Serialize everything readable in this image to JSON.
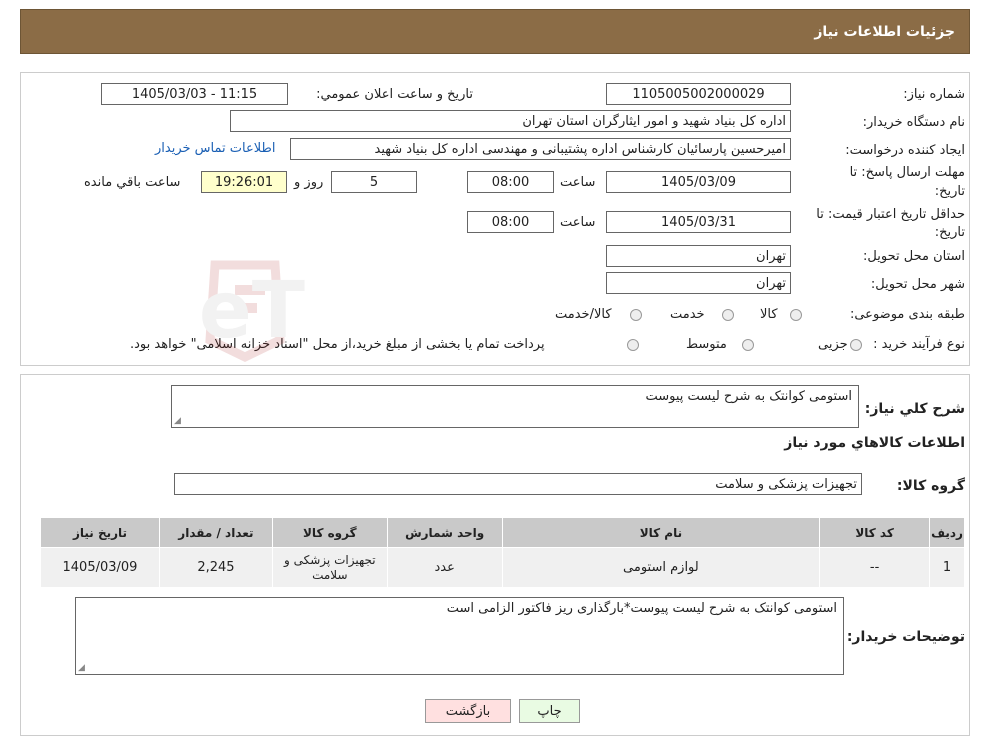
{
  "header": {
    "title": "جزئیات اطلاعات نیاز"
  },
  "form": {
    "need_number_label": "شماره نیاز:",
    "need_number": "1105005002000029",
    "announce_label": "تاريخ و ساعت اعلان عمومي:",
    "announce_value": "1405/03/03 - 11:15",
    "buyer_org_label": "نام دستگاه خریدار:",
    "buyer_org": "اداره کل بنیاد شهید و امور ایثارگران استان تهران",
    "creator_label": "ایجاد کننده درخواست:",
    "creator": "امیرحسین پارسائیان کارشناس اداره پشتیبانی و مهندسی  اداره کل بنیاد شهید",
    "contact_link": "اطلاعات تماس خریدار",
    "deadline_label_1": "مهلت ارسال پاسخ: تا",
    "deadline_label_2": "تاریخ:",
    "deadline_date": "1405/03/09",
    "time_label": "ساعت",
    "deadline_time": "08:00",
    "days": "5",
    "days_label": "روز و",
    "remaining_time": "19:26:01",
    "remaining_label": "ساعت باقي مانده",
    "validity_label_1": "حداقل تاریخ اعتبار قیمت: تا",
    "validity_label_2": "تاریخ:",
    "validity_date": "1405/03/31",
    "validity_time": "08:00",
    "province_label": "استان محل تحویل:",
    "province": "تهران",
    "city_label": "شهر محل تحویل:",
    "city": "تهران",
    "category_label": "طبقه بندی موضوعی:",
    "category_options": [
      "کالا",
      "خدمت",
      "کالا/خدمت"
    ],
    "process_label": "نوع فرآیند خرید :",
    "process_options": [
      "جزیی",
      "متوسط"
    ],
    "process_note": "پرداخت تمام یا بخشی از مبلغ خرید،از محل \"اسناد خزانه اسلامی\" خواهد بود."
  },
  "summary": {
    "desc_label": "شرح کلي نياز:",
    "desc": "استومی  کوانتک به شرح لیست پیوست",
    "items_title": "اطلاعات کالاهاي مورد نياز",
    "group_label": "گروه کالا:",
    "group": "تجهیزات پزشکی و سلامت"
  },
  "table": {
    "headers": [
      "رديف",
      "کد کالا",
      "نام کالا",
      "واحد شمارش",
      "گروه کالا",
      "تعداد / مقدار",
      "تاريخ نياز"
    ],
    "rows": [
      [
        "1",
        "--",
        "لوازم استومی",
        "عدد",
        "تجهیزات پزشکی و سلامت",
        "2,245",
        "1405/03/09"
      ]
    ]
  },
  "buyer_notes": {
    "label": "توضیحات خریدار:",
    "text": "استومی  کوانتک به شرح لیست پیوست*بارگذاری ریز فاکتور الزامی است"
  },
  "buttons": {
    "print": "چاپ",
    "back": "بازگشت"
  },
  "colors": {
    "header_bg": "#8B6C46",
    "print_bg": "#E9FBE3",
    "back_bg": "#FFE0E0",
    "remaining_bg": "#FFFFCC"
  },
  "watermark": {
    "text": "AriaTender.neT"
  }
}
